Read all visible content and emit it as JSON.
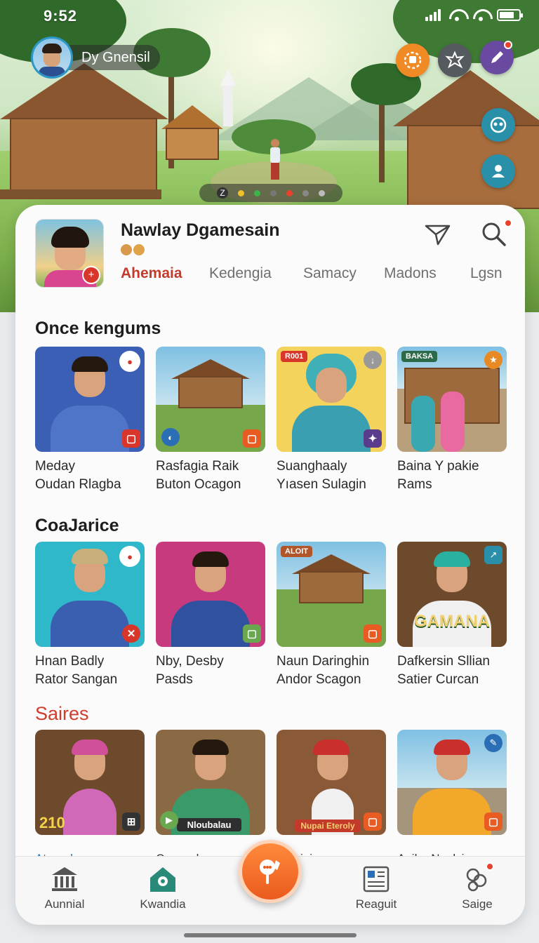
{
  "status_bar": {
    "time": "9:52"
  },
  "profile": {
    "name": "Dy Gnensil"
  },
  "header": {
    "title": "Nawlay Dgamesain",
    "tabs": [
      "Ahemaia",
      "Kedengia",
      "Samacy",
      "Madons",
      "Lgsn"
    ],
    "active_tab": 0
  },
  "sections": [
    {
      "title": "Once kengums",
      "items": [
        {
          "caption": "Meday\nOudan Rlagba",
          "badge_color": "#d9362b"
        },
        {
          "caption": "Rasfagia Raik\nButon Ocagon",
          "badge_color": "#e85c24"
        },
        {
          "caption": "Suanghaaly\nYıasen Sulagin",
          "badge_color": "#5a3c8c"
        },
        {
          "caption": "Baina Y pakie\nRams",
          "badge_color": "#e88a24"
        }
      ]
    },
    {
      "title": "CoaJarice",
      "items": [
        {
          "caption": "Hnan Badly\nRator Sangan",
          "badge_color": "#d9362b"
        },
        {
          "caption": "Nby, Desby\nPasds",
          "badge_color": "#6aa84f"
        },
        {
          "caption": "Naun Daringhin\nAndor Scagon",
          "badge_color": "#e85c24"
        },
        {
          "caption": "Dafkersin Sllian\nSatier Curcan",
          "badge_color": "#2a8fa8"
        }
      ],
      "poster_text": "GAMANA"
    },
    {
      "title": "Saires",
      "items": [
        {
          "tag": "210",
          "caption": "Ataerely"
        },
        {
          "tag": "Nloubalau",
          "caption": "Coacsel"
        },
        {
          "tag": "Nupai Eteroly",
          "caption": "Aejoioia"
        },
        {
          "tag": "",
          "caption": "Aaiba Naelsin"
        }
      ]
    }
  ],
  "bottom_nav": {
    "items": [
      "Aunnial",
      "Kwandia",
      "Reaguit",
      "Saige"
    ]
  },
  "colors": {
    "accent": "#c33b2c",
    "fab": "#ea5a1c",
    "hero_button_teal": "#2a8fa8",
    "hero_button_orange": "#f08a24",
    "hero_button_purple": "#6a4aa0"
  }
}
